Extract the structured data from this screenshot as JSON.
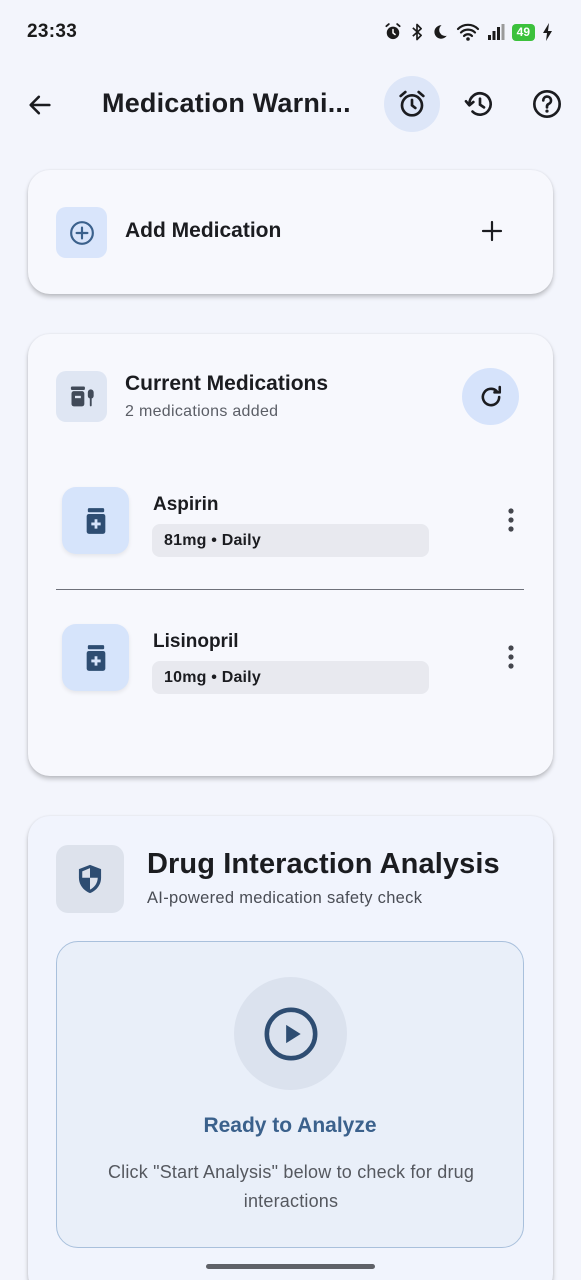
{
  "status_bar": {
    "time": "23:33",
    "battery": "49",
    "icons": [
      "alarm-icon",
      "bluetooth-icon",
      "moon-icon",
      "wifi-icon",
      "signal-icon",
      "battery-icon",
      "charging-icon"
    ]
  },
  "app_bar": {
    "title": "Medication Warni...",
    "actions": [
      "back-icon",
      "alarm-icon",
      "history-icon",
      "help-icon"
    ]
  },
  "add_card": {
    "label": "Add Medication"
  },
  "current_card": {
    "title": "Current Medications",
    "subtitle": "2 medications added",
    "medications": [
      {
        "name": "Aspirin",
        "dose": "81mg • Daily"
      },
      {
        "name": "Lisinopril",
        "dose": "10mg • Daily"
      }
    ]
  },
  "analysis_card": {
    "title": "Drug Interaction Analysis",
    "subtitle": "AI-powered medication safety check",
    "panel": {
      "title": "Ready to Analyze",
      "description": "Click \"Start Analysis\" below to check for drug interactions"
    }
  },
  "colors": {
    "background": "#f3f5fc",
    "accent": "#3b618c",
    "icon_tile": "#d9e5fb",
    "battery": "#3cc13c"
  }
}
